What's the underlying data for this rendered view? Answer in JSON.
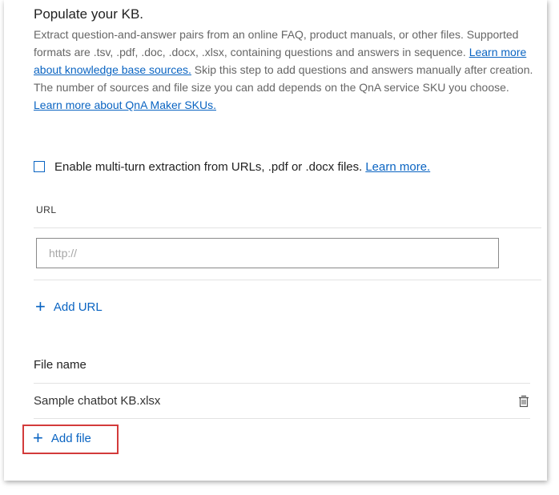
{
  "section": {
    "title": "Populate your KB.",
    "description_1": "Extract question-and-answer pairs from an online FAQ, product manuals, or other files. Supported formats are .tsv, .pdf, .doc, .docx, .xlsx, containing questions and answers in sequence.",
    "link_sources": "Learn more about knowledge base sources.",
    "description_2": " Skip this step to add questions and answers manually after creation. The number of sources and file size you can add depends on the QnA service SKU you choose.",
    "link_skus": "Learn more about QnA Maker SKUs."
  },
  "multiturn": {
    "label": "Enable multi-turn extraction from URLs, .pdf or .docx files.",
    "learn_more": "Learn more.",
    "checked": false
  },
  "url": {
    "label": "URL",
    "placeholder": "http://",
    "value": "",
    "add_label": "Add URL"
  },
  "files": {
    "header": "File name",
    "rows": [
      {
        "name": "Sample chatbot KB.xlsx"
      }
    ],
    "add_label": "Add file"
  },
  "colors": {
    "accent": "#0a64c2",
    "highlight": "#d33b3b"
  }
}
